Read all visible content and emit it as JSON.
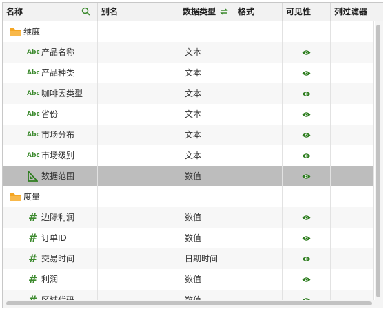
{
  "columns": {
    "name": "名称",
    "alias": "别名",
    "data_type": "数据类型",
    "format": "格式",
    "visibility": "可见性",
    "column_filter": "列过滤器"
  },
  "colors": {
    "accent": "#3c8a2e",
    "selected_row": "#bdbdbd",
    "folder": "#f5a623"
  },
  "groups": [
    {
      "label": "维度",
      "icon": "folder-icon",
      "fields": [
        {
          "name": "产品名称",
          "type": "文本",
          "icon": "text-field-icon",
          "visible": true
        },
        {
          "name": "产品种类",
          "type": "文本",
          "icon": "text-field-icon",
          "visible": true
        },
        {
          "name": "咖啡因类型",
          "type": "文本",
          "icon": "text-field-icon",
          "visible": true
        },
        {
          "name": "省份",
          "type": "文本",
          "icon": "text-field-icon",
          "visible": true
        },
        {
          "name": "市场分布",
          "type": "文本",
          "icon": "text-field-icon",
          "visible": true
        },
        {
          "name": "市场级别",
          "type": "文本",
          "icon": "text-field-icon",
          "visible": true
        },
        {
          "name": "数据范围",
          "type": "数值",
          "icon": "ruler-icon",
          "visible": true,
          "selected": true
        }
      ]
    },
    {
      "label": "度量",
      "icon": "folder-icon",
      "fields": [
        {
          "name": "边际利润",
          "type": "数值",
          "icon": "number-field-icon",
          "visible": true
        },
        {
          "name": "订单ID",
          "type": "数值",
          "icon": "number-field-icon",
          "visible": true
        },
        {
          "name": "交易时间",
          "type": "日期时间",
          "icon": "number-field-icon",
          "visible": true
        },
        {
          "name": "利润",
          "type": "数值",
          "icon": "number-field-icon",
          "visible": true
        },
        {
          "name": "区域代码",
          "type": "数值",
          "icon": "number-field-icon",
          "visible": true
        }
      ]
    }
  ],
  "icon_labels": {
    "abc": "Abc",
    "hash": "#"
  }
}
